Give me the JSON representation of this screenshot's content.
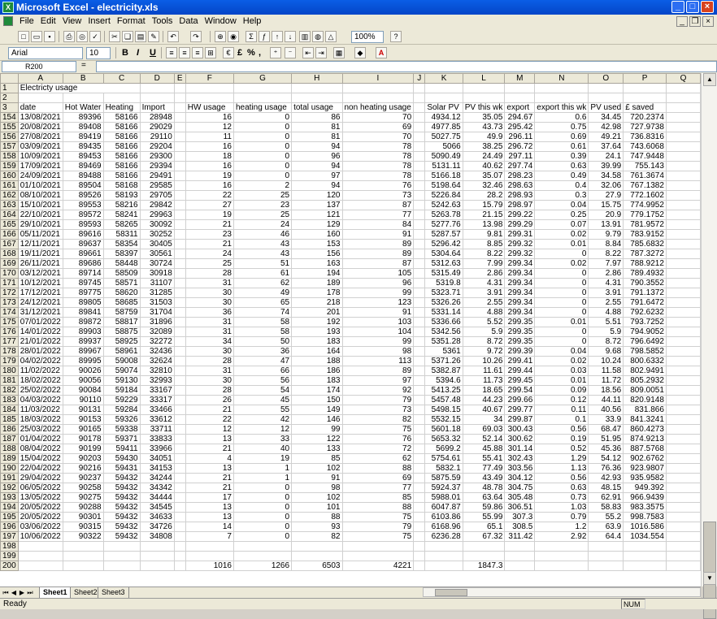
{
  "window": {
    "title": "Microsoft Excel - electricity.xls"
  },
  "menu": [
    "File",
    "Edit",
    "View",
    "Insert",
    "Format",
    "Tools",
    "Data",
    "Window",
    "Help"
  ],
  "toolbar": {
    "zoom": "100%",
    "font": "Arial",
    "font_size": "10",
    "bold": "B",
    "italic": "I",
    "underline": "U",
    "currency": "£",
    "percent": "%",
    "comma": ","
  },
  "formula_bar": {
    "name_box": "R200",
    "fx_value": ""
  },
  "columns": [
    "A",
    "B",
    "C",
    "D",
    "E",
    "F",
    "G",
    "H",
    "I",
    "J",
    "K",
    "L",
    "M",
    "N",
    "O",
    "P",
    "Q"
  ],
  "title_row": {
    "row": "1",
    "text": "Electricty usage"
  },
  "headers_row": {
    "row": "3",
    "cells": [
      "date",
      "Hot Water",
      "Heating",
      "Import",
      "",
      "HW usage",
      "heating usage",
      "total usage",
      "non heating usage",
      "",
      "Solar PV",
      "PV this wk",
      "export",
      "export this wk",
      "PV used",
      "£ saved",
      ""
    ]
  },
  "rows": [
    [
      "154",
      "13/08/2021",
      "89396",
      "58166",
      "28948",
      "",
      "16",
      "0",
      "86",
      "70",
      "",
      "4934.12",
      "35.05",
      "294.67",
      "0.6",
      "34.45",
      "720.2374"
    ],
    [
      "155",
      "20/08/2021",
      "89408",
      "58166",
      "29029",
      "",
      "12",
      "0",
      "81",
      "69",
      "",
      "4977.85",
      "43.73",
      "295.42",
      "0.75",
      "42.98",
      "727.9738"
    ],
    [
      "156",
      "27/08/2021",
      "89419",
      "58166",
      "29110",
      "",
      "11",
      "0",
      "81",
      "70",
      "",
      "5027.75",
      "49.9",
      "296.11",
      "0.69",
      "49.21",
      "736.8316"
    ],
    [
      "157",
      "03/09/2021",
      "89435",
      "58166",
      "29204",
      "",
      "16",
      "0",
      "94",
      "78",
      "",
      "5066",
      "38.25",
      "296.72",
      "0.61",
      "37.64",
      "743.6068"
    ],
    [
      "158",
      "10/09/2021",
      "89453",
      "58166",
      "29300",
      "",
      "18",
      "0",
      "96",
      "78",
      "",
      "5090.49",
      "24.49",
      "297.11",
      "0.39",
      "24.1",
      "747.9448"
    ],
    [
      "159",
      "17/09/2021",
      "89469",
      "58166",
      "29394",
      "",
      "16",
      "0",
      "94",
      "78",
      "",
      "5131.11",
      "40.62",
      "297.74",
      "0.63",
      "39.99",
      "755.143"
    ],
    [
      "160",
      "24/09/2021",
      "89488",
      "58166",
      "29491",
      "",
      "19",
      "0",
      "97",
      "78",
      "",
      "5166.18",
      "35.07",
      "298.23",
      "0.49",
      "34.58",
      "761.3674"
    ],
    [
      "161",
      "01/10/2021",
      "89504",
      "58168",
      "29585",
      "",
      "16",
      "2",
      "94",
      "76",
      "",
      "5198.64",
      "32.46",
      "298.63",
      "0.4",
      "32.06",
      "767.1382"
    ],
    [
      "162",
      "08/10/2021",
      "89526",
      "58193",
      "29705",
      "",
      "22",
      "25",
      "120",
      "73",
      "",
      "5226.84",
      "28.2",
      "298.93",
      "0.3",
      "27.9",
      "772.1602"
    ],
    [
      "163",
      "15/10/2021",
      "89553",
      "58216",
      "29842",
      "",
      "27",
      "23",
      "137",
      "87",
      "",
      "5242.63",
      "15.79",
      "298.97",
      "0.04",
      "15.75",
      "774.9952"
    ],
    [
      "164",
      "22/10/2021",
      "89572",
      "58241",
      "29963",
      "",
      "19",
      "25",
      "121",
      "77",
      "",
      "5263.78",
      "21.15",
      "299.22",
      "0.25",
      "20.9",
      "779.1752"
    ],
    [
      "165",
      "29/10/2021",
      "89593",
      "58265",
      "30092",
      "",
      "21",
      "24",
      "129",
      "84",
      "",
      "5277.76",
      "13.98",
      "299.29",
      "0.07",
      "13.91",
      "781.9572"
    ],
    [
      "166",
      "05/11/2021",
      "89616",
      "58311",
      "30252",
      "",
      "23",
      "46",
      "160",
      "91",
      "",
      "5287.57",
      "9.81",
      "299.31",
      "0.02",
      "9.79",
      "783.9152"
    ],
    [
      "167",
      "12/11/2021",
      "89637",
      "58354",
      "30405",
      "",
      "21",
      "43",
      "153",
      "89",
      "",
      "5296.42",
      "8.85",
      "299.32",
      "0.01",
      "8.84",
      "785.6832"
    ],
    [
      "168",
      "19/11/2021",
      "89661",
      "58397",
      "30561",
      "",
      "24",
      "43",
      "156",
      "89",
      "",
      "5304.64",
      "8.22",
      "299.32",
      "0",
      "8.22",
      "787.3272"
    ],
    [
      "169",
      "26/11/2021",
      "89686",
      "58448",
      "30724",
      "",
      "25",
      "51",
      "163",
      "87",
      "",
      "5312.63",
      "7.99",
      "299.34",
      "0.02",
      "7.97",
      "788.9212"
    ],
    [
      "170",
      "03/12/2021",
      "89714",
      "58509",
      "30918",
      "",
      "28",
      "61",
      "194",
      "105",
      "",
      "5315.49",
      "2.86",
      "299.34",
      "0",
      "2.86",
      "789.4932"
    ],
    [
      "171",
      "10/12/2021",
      "89745",
      "58571",
      "31107",
      "",
      "31",
      "62",
      "189",
      "96",
      "",
      "5319.8",
      "4.31",
      "299.34",
      "0",
      "4.31",
      "790.3552"
    ],
    [
      "172",
      "17/12/2021",
      "89775",
      "58620",
      "31285",
      "",
      "30",
      "49",
      "178",
      "99",
      "",
      "5323.71",
      "3.91",
      "299.34",
      "0",
      "3.91",
      "791.1372"
    ],
    [
      "173",
      "24/12/2021",
      "89805",
      "58685",
      "31503",
      "",
      "30",
      "65",
      "218",
      "123",
      "",
      "5326.26",
      "2.55",
      "299.34",
      "0",
      "2.55",
      "791.6472"
    ],
    [
      "174",
      "31/12/2021",
      "89841",
      "58759",
      "31704",
      "",
      "36",
      "74",
      "201",
      "91",
      "",
      "5331.14",
      "4.88",
      "299.34",
      "0",
      "4.88",
      "792.6232"
    ],
    [
      "175",
      "07/01/2022",
      "89872",
      "58817",
      "31896",
      "",
      "31",
      "58",
      "192",
      "103",
      "",
      "5336.66",
      "5.52",
      "299.35",
      "0.01",
      "5.51",
      "793.7252"
    ],
    [
      "176",
      "14/01/2022",
      "89903",
      "58875",
      "32089",
      "",
      "31",
      "58",
      "193",
      "104",
      "",
      "5342.56",
      "5.9",
      "299.35",
      "0",
      "5.9",
      "794.9052"
    ],
    [
      "177",
      "21/01/2022",
      "89937",
      "58925",
      "32272",
      "",
      "34",
      "50",
      "183",
      "99",
      "",
      "5351.28",
      "8.72",
      "299.35",
      "0",
      "8.72",
      "796.6492"
    ],
    [
      "178",
      "28/01/2022",
      "89967",
      "58961",
      "32436",
      "",
      "30",
      "36",
      "164",
      "98",
      "",
      "5361",
      "9.72",
      "299.39",
      "0.04",
      "9.68",
      "798.5852"
    ],
    [
      "179",
      "04/02/2022",
      "89995",
      "59008",
      "32624",
      "",
      "28",
      "47",
      "188",
      "113",
      "",
      "5371.26",
      "10.26",
      "299.41",
      "0.02",
      "10.24",
      "800.6332"
    ],
    [
      "180",
      "11/02/2022",
      "90026",
      "59074",
      "32810",
      "",
      "31",
      "66",
      "186",
      "89",
      "",
      "5382.87",
      "11.61",
      "299.44",
      "0.03",
      "11.58",
      "802.9491"
    ],
    [
      "181",
      "18/02/2022",
      "90056",
      "59130",
      "32993",
      "",
      "30",
      "56",
      "183",
      "97",
      "",
      "5394.6",
      "11.73",
      "299.45",
      "0.01",
      "11.72",
      "805.2932"
    ],
    [
      "182",
      "25/02/2022",
      "90084",
      "59184",
      "33167",
      "",
      "28",
      "54",
      "174",
      "92",
      "",
      "5413.25",
      "18.65",
      "299.54",
      "0.09",
      "18.56",
      "809.0051"
    ],
    [
      "183",
      "04/03/2022",
      "90110",
      "59229",
      "33317",
      "",
      "26",
      "45",
      "150",
      "79",
      "",
      "5457.48",
      "44.23",
      "299.66",
      "0.12",
      "44.11",
      "820.9148"
    ],
    [
      "184",
      "11/03/2022",
      "90131",
      "59284",
      "33466",
      "",
      "21",
      "55",
      "149",
      "73",
      "",
      "5498.15",
      "40.67",
      "299.77",
      "0.11",
      "40.56",
      "831.866"
    ],
    [
      "185",
      "18/03/2022",
      "90153",
      "59326",
      "33612",
      "",
      "22",
      "42",
      "146",
      "82",
      "",
      "5532.15",
      "34",
      "299.87",
      "0.1",
      "33.9",
      "841.3241"
    ],
    [
      "186",
      "25/03/2022",
      "90165",
      "59338",
      "33711",
      "",
      "12",
      "12",
      "99",
      "75",
      "",
      "5601.18",
      "69.03",
      "300.43",
      "0.56",
      "68.47",
      "860.4273"
    ],
    [
      "187",
      "01/04/2022",
      "90178",
      "59371",
      "33833",
      "",
      "13",
      "33",
      "122",
      "76",
      "",
      "5653.32",
      "52.14",
      "300.62",
      "0.19",
      "51.95",
      "874.9213"
    ],
    [
      "188",
      "08/04/2022",
      "90199",
      "59411",
      "33966",
      "",
      "21",
      "40",
      "133",
      "72",
      "",
      "5699.2",
      "45.88",
      "301.14",
      "0.52",
      "45.36",
      "887.5768"
    ],
    [
      "189",
      "15/04/2022",
      "90203",
      "59430",
      "34051",
      "",
      "4",
      "19",
      "85",
      "62",
      "",
      "5754.61",
      "55.41",
      "302.43",
      "1.29",
      "54.12",
      "902.6762"
    ],
    [
      "190",
      "22/04/2022",
      "90216",
      "59431",
      "34153",
      "",
      "13",
      "1",
      "102",
      "88",
      "",
      "5832.1",
      "77.49",
      "303.56",
      "1.13",
      "76.36",
      "923.9807"
    ],
    [
      "191",
      "29/04/2022",
      "90237",
      "59432",
      "34244",
      "",
      "21",
      "1",
      "91",
      "69",
      "",
      "5875.59",
      "43.49",
      "304.12",
      "0.56",
      "42.93",
      "935.9582"
    ],
    [
      "192",
      "06/05/2022",
      "90258",
      "59432",
      "34342",
      "",
      "21",
      "0",
      "98",
      "77",
      "",
      "5924.37",
      "48.78",
      "304.75",
      "0.63",
      "48.15",
      "949.392"
    ],
    [
      "193",
      "13/05/2022",
      "90275",
      "59432",
      "34444",
      "",
      "17",
      "0",
      "102",
      "85",
      "",
      "5988.01",
      "63.64",
      "305.48",
      "0.73",
      "62.91",
      "966.9439"
    ],
    [
      "194",
      "20/05/2022",
      "90288",
      "59432",
      "34545",
      "",
      "13",
      "0",
      "101",
      "88",
      "",
      "6047.87",
      "59.86",
      "306.51",
      "1.03",
      "58.83",
      "983.3575"
    ],
    [
      "195",
      "20/05/2022",
      "90301",
      "59432",
      "34633",
      "",
      "13",
      "0",
      "88",
      "75",
      "",
      "6103.86",
      "55.99",
      "307.3",
      "0.79",
      "55.2",
      "998.7583"
    ],
    [
      "196",
      "03/06/2022",
      "90315",
      "59432",
      "34726",
      "",
      "14",
      "0",
      "93",
      "79",
      "",
      "6168.96",
      "65.1",
      "308.5",
      "1.2",
      "63.9",
      "1016.586"
    ],
    [
      "197",
      "10/06/2022",
      "90322",
      "59432",
      "34808",
      "",
      "7",
      "0",
      "82",
      "75",
      "",
      "6236.28",
      "67.32",
      "311.42",
      "2.92",
      "64.4",
      "1034.554"
    ],
    [
      "198",
      "",
      "",
      "",
      "",
      "",
      "",
      "",
      "",
      "",
      "",
      "",
      "",
      "",
      "",
      "",
      ""
    ],
    [
      "199",
      "",
      "",
      "",
      "",
      "",
      "",
      "",
      "",
      "",
      "",
      "",
      "",
      "",
      "",
      "",
      ""
    ],
    [
      "200",
      "",
      "",
      "",
      "",
      "",
      "1016",
      "1266",
      "6503",
      "4221",
      "",
      "",
      "1847.3",
      "",
      "",
      "",
      ""
    ]
  ],
  "sheets": [
    "Sheet1",
    "Sheet2",
    "Sheet3"
  ],
  "status": {
    "left": "Ready",
    "num": "NUM"
  }
}
